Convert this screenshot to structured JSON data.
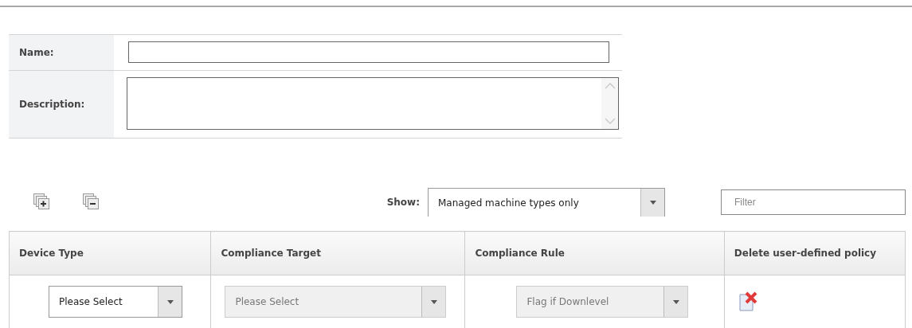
{
  "form": {
    "fields": [
      {
        "label": "Name:",
        "kind": "input"
      },
      {
        "label": "Description:",
        "kind": "textarea"
      }
    ]
  },
  "toolbar": {
    "show_label": "Show:",
    "show_value": "Managed machine types only",
    "filter": {
      "placeholder": "Filter"
    }
  },
  "table": {
    "columns": [
      "Device Type",
      "Compliance Target",
      "Compliance Rule",
      "Delete user-defined policy"
    ],
    "rows": [
      {
        "device_type": {
          "value": "Please Select",
          "disabled": false
        },
        "compliance_target": {
          "value": "Please Select",
          "disabled": true
        },
        "compliance_rule": {
          "value": "Flag if Downlevel",
          "disabled": true
        }
      }
    ]
  }
}
